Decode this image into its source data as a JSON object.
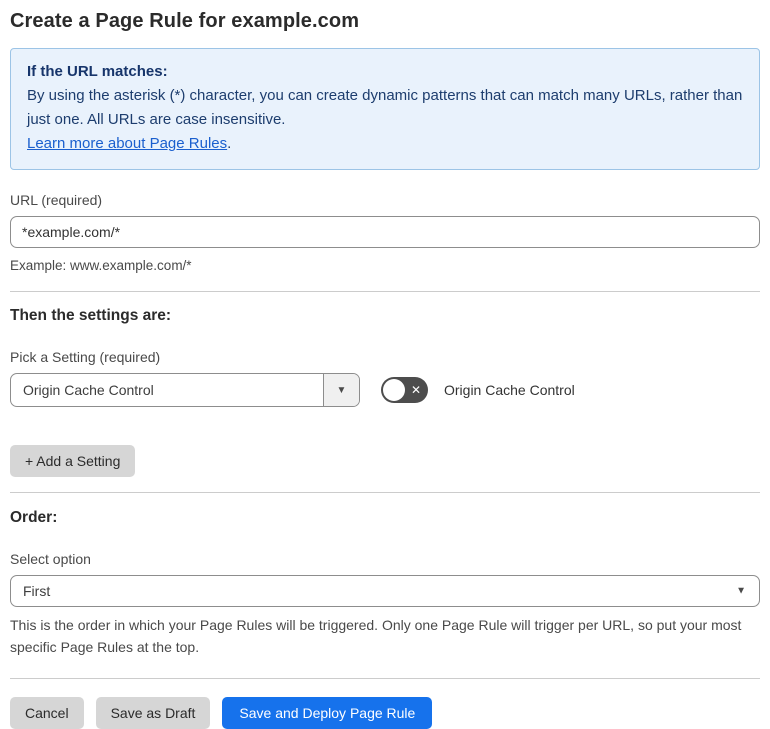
{
  "page": {
    "title": "Create a Page Rule for example.com"
  },
  "info_box": {
    "heading": "If the URL matches:",
    "body": "By using the asterisk (*) character, you can create dynamic patterns that can match many URLs, rather than just one. All URLs are case insensitive.",
    "link_label": "Learn more about Page Rules",
    "link_suffix": "."
  },
  "url_field": {
    "label": "URL (required)",
    "value": "*example.com/*",
    "helper": "Example: www.example.com/*"
  },
  "settings_section": {
    "heading": "Then the settings are:",
    "picker_label": "Pick a Setting (required)",
    "picker_value": "Origin Cache Control",
    "toggle_label": "Origin Cache Control",
    "toggle_state": "off",
    "add_setting_label": "+ Add a Setting"
  },
  "order_section": {
    "heading": "Order:",
    "select_label": "Select option",
    "select_value": "First",
    "helper": "This is the order in which your Page Rules will be triggered. Only one Page Rule will trigger per URL, so put your most specific Page Rules at the top."
  },
  "footer": {
    "cancel_label": "Cancel",
    "save_draft_label": "Save as Draft",
    "save_deploy_label": "Save and Deploy Page Rule"
  },
  "icons": {
    "dropdown_arrow": "▼",
    "toggle_off_x": "✕"
  },
  "colors": {
    "accent_blue": "#1672ec",
    "info_bg": "#e9f2fc",
    "info_border": "#9cc4e6",
    "info_text": "#1d3d6e",
    "link_blue": "#1a5fce",
    "toggle_off_bg": "#4d4d4d",
    "button_gray": "#d6d6d6"
  }
}
